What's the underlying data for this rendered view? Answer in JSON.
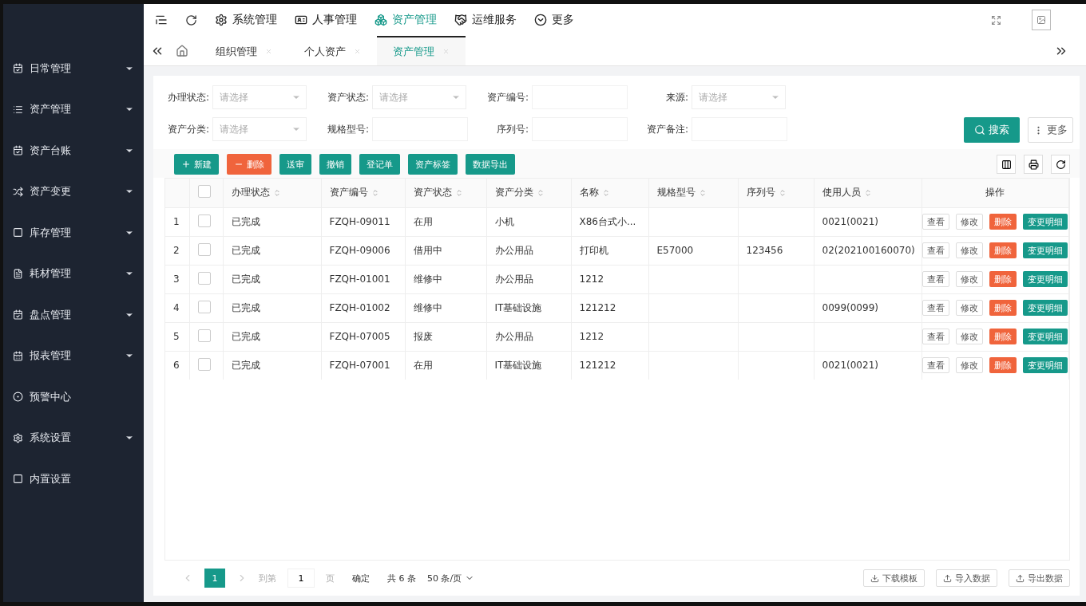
{
  "sidebar": {
    "items": [
      {
        "label": "日常管理",
        "expandable": true
      },
      {
        "label": "资产管理",
        "expandable": true
      },
      {
        "label": "资产台账",
        "expandable": true
      },
      {
        "label": "资产变更",
        "expandable": true
      },
      {
        "label": "库存管理",
        "expandable": true
      },
      {
        "label": "耗材管理",
        "expandable": true
      },
      {
        "label": "盘点管理",
        "expandable": true
      },
      {
        "label": "报表管理",
        "expandable": true
      },
      {
        "label": "预警中心",
        "expandable": false
      },
      {
        "label": "系统设置",
        "expandable": true
      },
      {
        "label": "内置设置",
        "expandable": false
      }
    ]
  },
  "topnav": {
    "items": [
      {
        "label": "系统管理",
        "selected": false
      },
      {
        "label": "人事管理",
        "selected": false
      },
      {
        "label": "资产管理",
        "selected": true
      },
      {
        "label": "运维服务",
        "selected": false
      },
      {
        "label": "更多",
        "selected": false
      }
    ]
  },
  "tabs": [
    {
      "label": "组织管理",
      "selected": false
    },
    {
      "label": "个人资产",
      "selected": false
    },
    {
      "label": "资产管理",
      "selected": true
    }
  ],
  "filters": [
    [
      {
        "label": "办理状态:",
        "kind": "select",
        "placeholder": "请选择"
      },
      {
        "label": "资产状态:",
        "kind": "select",
        "placeholder": "请选择"
      },
      {
        "label": "资产编号:",
        "kind": "text"
      },
      {
        "label": "来源:",
        "kind": "select",
        "placeholder": "请选择"
      }
    ],
    [
      {
        "label": "资产分类:",
        "kind": "select",
        "placeholder": "请选择"
      },
      {
        "label": "规格型号:",
        "kind": "text"
      },
      {
        "label": "序列号:",
        "kind": "text"
      },
      {
        "label": "资产备注:",
        "kind": "text"
      }
    ]
  ],
  "search_button": "搜索",
  "more_button": "更多",
  "toolbar": [
    {
      "label": "新建",
      "kind": "primary"
    },
    {
      "label": "删除",
      "kind": "danger"
    },
    {
      "label": "送审",
      "kind": "primary"
    },
    {
      "label": "撤销",
      "kind": "primary"
    },
    {
      "label": "登记单",
      "kind": "primary"
    },
    {
      "label": "资产标签",
      "kind": "primary"
    },
    {
      "label": "数据导出",
      "kind": "primary"
    }
  ],
  "table": {
    "header_checked": false,
    "columns": [
      {
        "label": "办理状态",
        "sortable": true
      },
      {
        "label": "资产编号",
        "sortable": true
      },
      {
        "label": "资产状态",
        "sortable": true
      },
      {
        "label": "资产分类",
        "sortable": true
      },
      {
        "label": "名称",
        "sortable": true
      },
      {
        "label": "规格型号",
        "sortable": true
      },
      {
        "label": "序列号",
        "sortable": true
      },
      {
        "label": "使用人员",
        "sortable": true
      },
      {
        "label": "操作",
        "sortable": false
      }
    ],
    "rows": [
      {
        "index": "1",
        "checked": false,
        "cells": [
          "已完成",
          "FZQH-09011",
          "在用",
          "小机",
          "X86台式小...",
          "",
          "",
          "0021(0021)"
        ],
        "actions": [
          {
            "label": "查看",
            "kind": "default"
          },
          {
            "label": "修改",
            "kind": "default"
          },
          {
            "label": "删除",
            "kind": "danger"
          },
          {
            "label": "变更明细",
            "kind": "primary"
          }
        ]
      },
      {
        "index": "2",
        "checked": false,
        "cells": [
          "已完成",
          "FZQH-09006",
          "借用中",
          "办公用品",
          "打印机",
          "E57000",
          "123456",
          "02(202100160070)"
        ],
        "actions": [
          {
            "label": "查看",
            "kind": "default"
          },
          {
            "label": "修改",
            "kind": "default"
          },
          {
            "label": "删除",
            "kind": "danger"
          },
          {
            "label": "变更明细",
            "kind": "primary"
          }
        ]
      },
      {
        "index": "3",
        "checked": false,
        "cells": [
          "已完成",
          "FZQH-01001",
          "维修中",
          "办公用品",
          "1212",
          "",
          "",
          ""
        ],
        "actions": [
          {
            "label": "查看",
            "kind": "default"
          },
          {
            "label": "修改",
            "kind": "default"
          },
          {
            "label": "删除",
            "kind": "danger"
          },
          {
            "label": "变更明细",
            "kind": "primary"
          }
        ]
      },
      {
        "index": "4",
        "checked": false,
        "cells": [
          "已完成",
          "FZQH-01002",
          "维修中",
          "IT基础设施",
          "121212",
          "",
          "",
          "0099(0099)"
        ],
        "actions": [
          {
            "label": "查看",
            "kind": "default"
          },
          {
            "label": "修改",
            "kind": "default"
          },
          {
            "label": "删除",
            "kind": "danger"
          },
          {
            "label": "变更明细",
            "kind": "primary"
          }
        ]
      },
      {
        "index": "5",
        "checked": false,
        "cells": [
          "已完成",
          "FZQH-07005",
          "报废",
          "办公用品",
          "1212",
          "",
          "",
          ""
        ],
        "actions": [
          {
            "label": "查看",
            "kind": "default"
          },
          {
            "label": "修改",
            "kind": "default"
          },
          {
            "label": "删除",
            "kind": "danger"
          },
          {
            "label": "变更明细",
            "kind": "primary"
          }
        ]
      },
      {
        "index": "6",
        "checked": false,
        "cells": [
          "已完成",
          "FZQH-07001",
          "在用",
          "IT基础设施",
          "121212",
          "",
          "",
          "0021(0021)"
        ],
        "actions": [
          {
            "label": "查看",
            "kind": "default"
          },
          {
            "label": "修改",
            "kind": "default"
          },
          {
            "label": "删除",
            "kind": "danger"
          },
          {
            "label": "变更明细",
            "kind": "primary"
          }
        ]
      }
    ]
  },
  "pagination": {
    "pages": [
      {
        "label": "1",
        "selected": true
      }
    ],
    "goto_label": "到第",
    "goto_value": "1",
    "page_unit": "页",
    "confirm": "确定",
    "total": "共 6 条",
    "page_size": "50 条/页"
  },
  "footer_buttons": [
    "下载模板",
    "导入数据",
    "导出数据"
  ]
}
